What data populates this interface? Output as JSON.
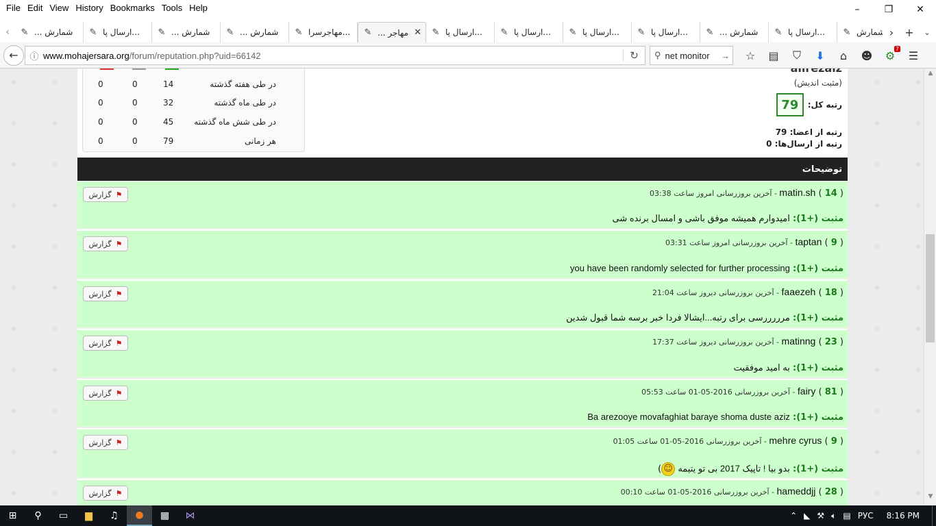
{
  "menu": [
    "File",
    "Edit",
    "View",
    "History",
    "Bookmarks",
    "Tools",
    "Help"
  ],
  "window_controls": {
    "minimize": "–",
    "restore": "❐",
    "close": "✕"
  },
  "tabs": [
    {
      "title": "... شمارش",
      "active": false
    },
    {
      "title": "ارسال پا...",
      "active": false
    },
    {
      "title": "... شمارش",
      "active": false
    },
    {
      "title": "... شمارش",
      "active": false
    },
    {
      "title": "مهاجرسرا...",
      "active": false
    },
    {
      "title": "... مهاجر",
      "active": true
    },
    {
      "title": "ارسال پا...",
      "active": false
    },
    {
      "title": "ارسال پا...",
      "active": false
    },
    {
      "title": "ارسال پا...",
      "active": false
    },
    {
      "title": "ارسال پا...",
      "active": false
    },
    {
      "title": "... شمارش",
      "active": false
    },
    {
      "title": "ارسال پا...",
      "active": false
    },
    {
      "title": "شمارش",
      "active": false
    }
  ],
  "nav": {
    "url_domain": "www.mohajersara.org",
    "url_path": "/forum/reputation.php?uid=66142",
    "search_value": "net monitor",
    "addon_badge": "7"
  },
  "profile": {
    "username": "alirezaiz",
    "user_title": "(مثبت اندیش)",
    "total_label": "رتبه کل:",
    "total_value": "79",
    "from_members_label": "رتبه از اعضا:",
    "from_members_value": "79",
    "from_posts_label": "رتبه از ارسال‌ها:",
    "from_posts_value": "0"
  },
  "stats": [
    {
      "period": "در طی هفته گذشته",
      "pos": "14",
      "neu": "0",
      "neg": "0"
    },
    {
      "period": "در طی ماه گذشته",
      "pos": "32",
      "neu": "0",
      "neg": "0"
    },
    {
      "period": "در طی شش ماه گذشته",
      "pos": "45",
      "neu": "0",
      "neg": "0"
    },
    {
      "period": "هر زمانی",
      "pos": "79",
      "neu": "0",
      "neg": "0"
    }
  ],
  "comments_title": "توضیحات",
  "report_label": "گزارش",
  "positive_label": "مثبت (+1):",
  "entries": [
    {
      "user": "matin.sh",
      "count": "14",
      "updated": "- آخرین بروزرسانی امروز ساعت 03:38",
      "message": "امیدوارم همیشه موفق باشی و امسال برنده شی"
    },
    {
      "user": "taptan",
      "count": "9",
      "updated": "- آخرین بروزرسانی امروز ساعت 03:31",
      "message": "you have been randomly selected for further processing"
    },
    {
      "user": "faaezeh",
      "count": "18",
      "updated": "- آخرین بروزرسانی دیروز ساعت 21:04",
      "message": "مرررررسی برای رتبه...ایشالا فردا خبر برسه شما قبول شدین"
    },
    {
      "user": "matinng",
      "count": "23",
      "updated": "- آخرین بروزرسانی دیروز ساعت 17:37",
      "message": "به امید موفقیت"
    },
    {
      "user": "fairy",
      "count": "81",
      "updated": "- آخرین بروزرسانی 2016-05-01 ساعت 05:53",
      "message": "Ba arezooye movafaghiat baraye shoma duste aziz"
    },
    {
      "user": "mehre cyrus",
      "count": "9",
      "updated": "- آخرین بروزرسانی 2016-05-01 ساعت 01:05",
      "message": "بدو بیا ! تاپیک 2017 بی تو یتیمه"
    },
    {
      "user": "hameddjj",
      "count": "28",
      "updated": "- آخرین بروزرسانی 2016-05-01 ساعت 00:10",
      "message": ""
    }
  ],
  "taskbar": {
    "lang": "РУС",
    "time": "8:16 PM"
  }
}
